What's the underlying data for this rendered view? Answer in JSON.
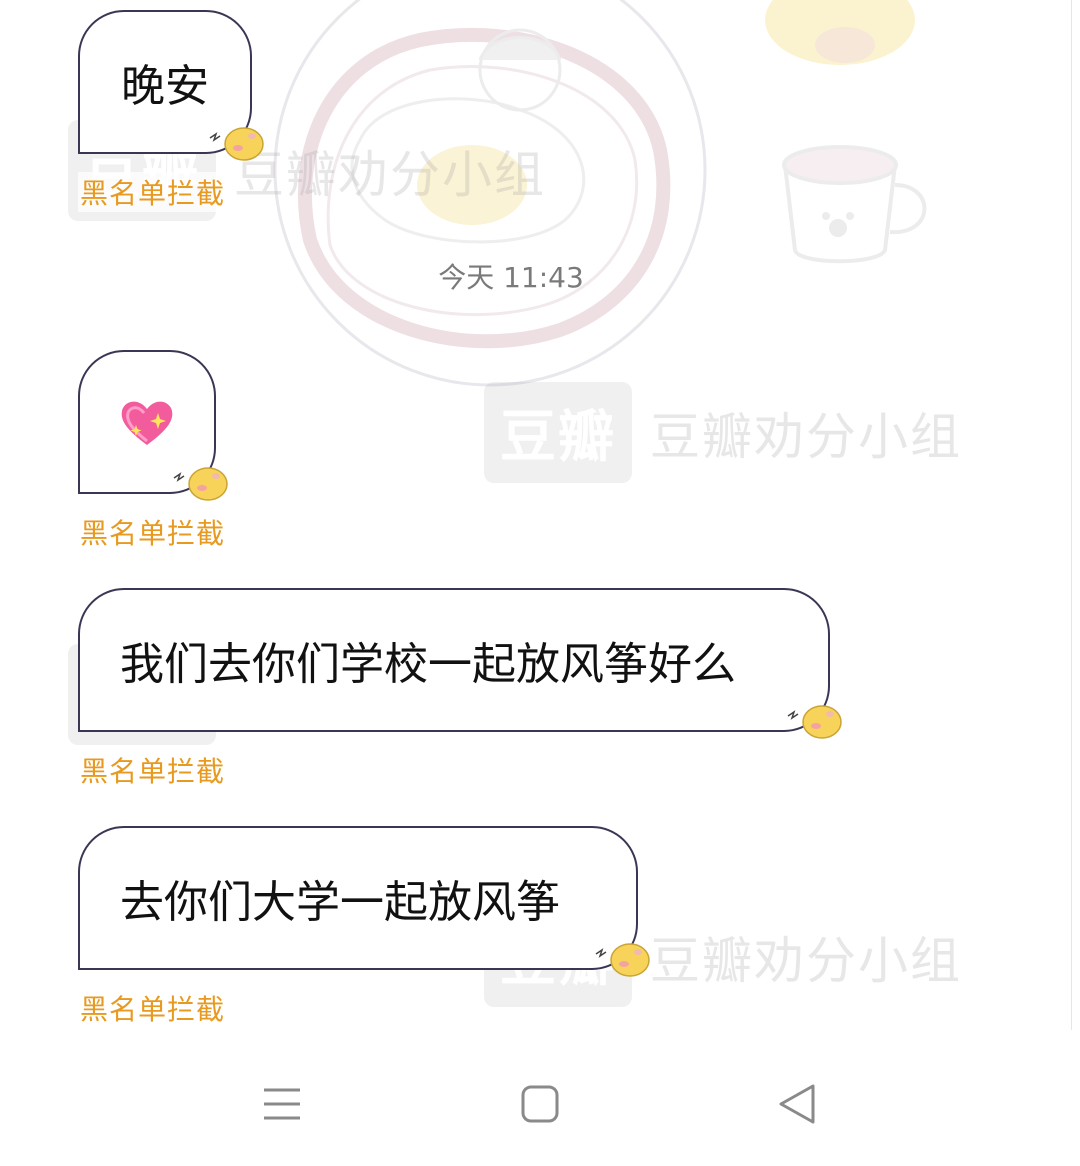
{
  "watermark": {
    "logo": "豆瓣",
    "text": "豆瓣劝分小组"
  },
  "chat": {
    "timestamp": "今天 11:43",
    "messages": [
      {
        "text": "晚安",
        "status": "黑名单拦截"
      },
      {
        "text": "💖",
        "status": "黑名单拦截"
      },
      {
        "text": "我们去你们学校一起放风筝好么",
        "status": "黑名单拦截"
      },
      {
        "text": "去你们大学一起放风筝",
        "status": "黑名单拦截"
      }
    ]
  },
  "nav": {
    "icons": [
      "menu-icon",
      "home-icon",
      "back-icon"
    ]
  },
  "colors": {
    "bubble_border": "#3a3654",
    "blocked_label": "#e89a20",
    "timestamp": "#7a7a7a",
    "hamster": "#f7d35a"
  }
}
